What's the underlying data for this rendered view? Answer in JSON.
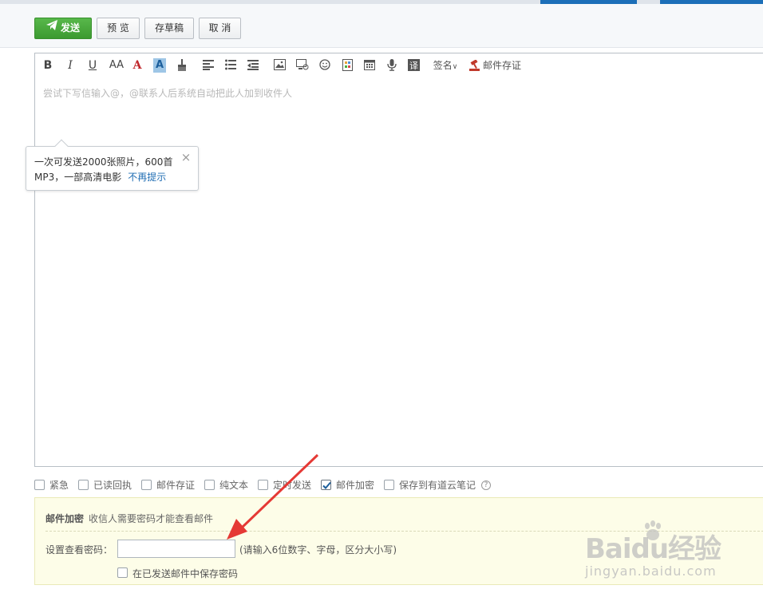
{
  "toolbar": {
    "send_label": "发送",
    "preview_label": "预 览",
    "draft_label": "存草稿",
    "cancel_label": "取 消"
  },
  "editor_tools": {
    "bold": "B",
    "italic": "I",
    "underline": "U",
    "font_size": "AA",
    "font_color": "A",
    "bg_color": "A",
    "signature": "签名",
    "mail_cert": "邮件存证"
  },
  "editor": {
    "placeholder": "尝试下写信输入@，@联系人后系统自动把此人加到收件人"
  },
  "tip": {
    "line1": "一次可发送2000张照片，600首",
    "line2": "MP3，一部高清电影",
    "no_more": "不再提示",
    "close": "×"
  },
  "options": [
    {
      "label": "紧急",
      "checked": false
    },
    {
      "label": "已读回执",
      "checked": false
    },
    {
      "label": "邮件存证",
      "checked": false
    },
    {
      "label": "纯文本",
      "checked": false
    },
    {
      "label": "定时发送",
      "checked": false
    },
    {
      "label": "邮件加密",
      "checked": true
    },
    {
      "label": "保存到有道云笔记",
      "checked": false
    }
  ],
  "encryption": {
    "title": "邮件加密",
    "description": "收信人需要密码才能查看邮件",
    "password_label": "设置查看密码：",
    "password_value": "",
    "password_hint": "(请输入6位数字、字母，区分大小写)",
    "save_label": "在已发送邮件中保存密码"
  },
  "watermark": {
    "logo": "Baidu经验",
    "site": "jingyan.baidu.com"
  },
  "colors": {
    "send_green": "#4caf3e",
    "accent_blue": "#1c6fb8",
    "annotation_red": "#e53935"
  }
}
